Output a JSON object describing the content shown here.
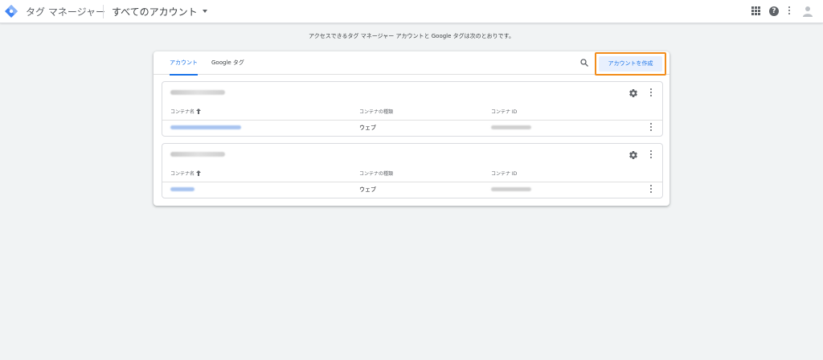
{
  "header": {
    "app_name": "タグ マネージャー",
    "account_selector": "すべてのアカウント"
  },
  "intro_text": "アクセスできるタグ マネージャー アカウントと Google タグは次のとおりです。",
  "tabs": [
    {
      "label": "アカウント",
      "active": true
    },
    {
      "label": "Google タグ",
      "active": false
    }
  ],
  "create_button": "アカウントを作成",
  "columns": {
    "name": "コンテナ名",
    "type": "コンテナの種類",
    "id": "コンテナ ID"
  },
  "accounts": [
    {
      "containers": [
        {
          "type": "ウェブ"
        }
      ]
    },
    {
      "containers": [
        {
          "type": "ウェブ"
        }
      ]
    }
  ],
  "colors": {
    "accent": "#1a73e8",
    "highlight_border": "#f28c1a",
    "background": "#f1f3f4"
  }
}
